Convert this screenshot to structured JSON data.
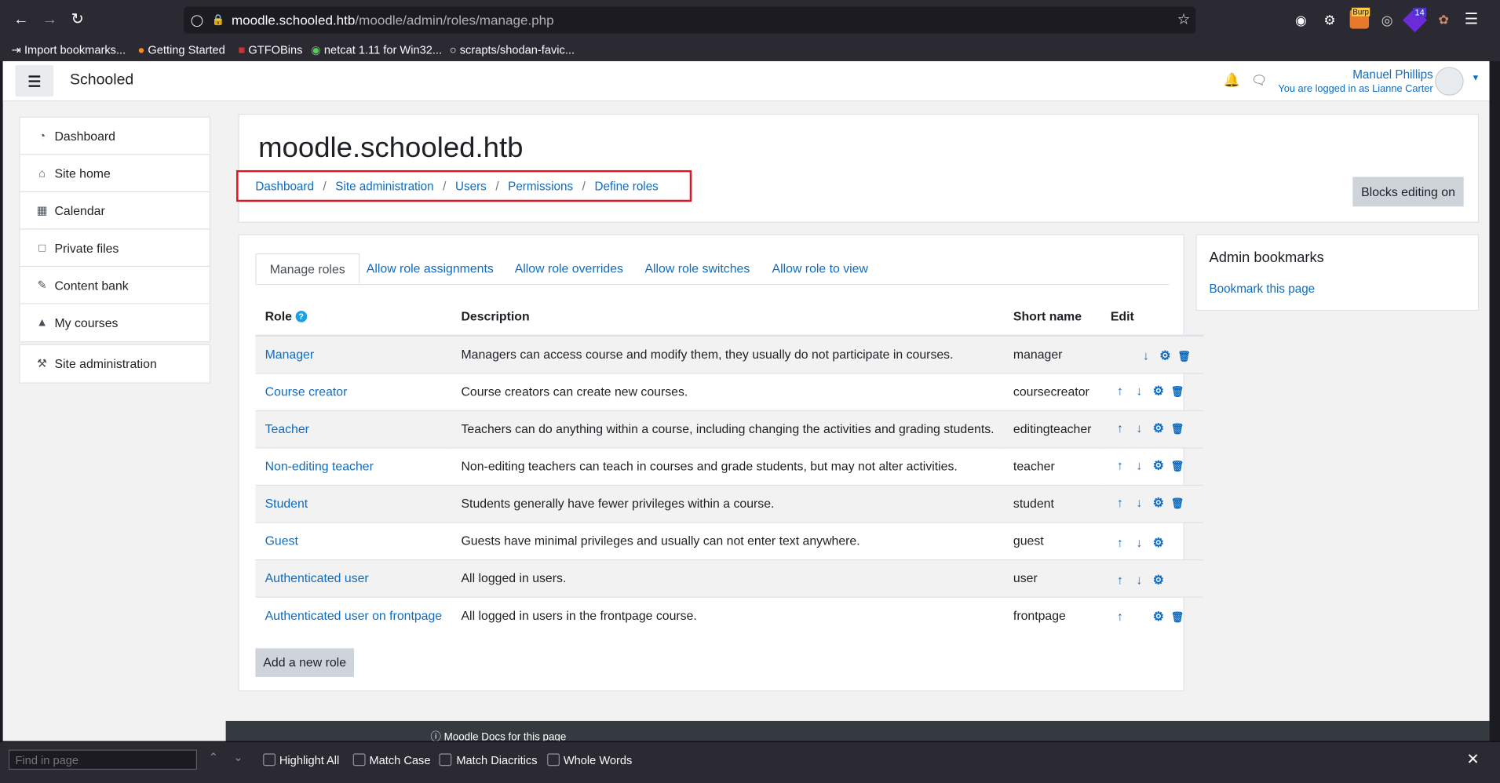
{
  "browser": {
    "url_host": "moodle.schooled.htb",
    "url_path": "/moodle/admin/roles/manage.php",
    "bookmarks": [
      {
        "label": "Import bookmarks...",
        "icon": "import-icon"
      },
      {
        "label": "Getting Started",
        "icon": "firefox-icon"
      },
      {
        "label": "GTFOBins",
        "icon": "gtfobins-icon"
      },
      {
        "label": "netcat 1.11 for Win32...",
        "icon": "netcat-icon"
      },
      {
        "label": "scrapts/shodan-favic...",
        "icon": "github-icon"
      }
    ],
    "extension_badge_burp": "Burp",
    "extension_badge_count": "14"
  },
  "navbar": {
    "site_name": "Schooled",
    "user_name": "Manuel Phillips",
    "logged_in_as": "You are logged in as Lianne Carter"
  },
  "sidebar": {
    "items": [
      {
        "label": "Dashboard",
        "icon": "dashboard-icon"
      },
      {
        "label": "Site home",
        "icon": "home-icon"
      },
      {
        "label": "Calendar",
        "icon": "calendar-icon"
      },
      {
        "label": "Private files",
        "icon": "file-icon"
      },
      {
        "label": "Content bank",
        "icon": "paintbrush-icon"
      },
      {
        "label": "My courses",
        "icon": "graduation-cap-icon"
      }
    ],
    "admin_item": {
      "label": "Site administration",
      "icon": "wrench-icon"
    }
  },
  "header": {
    "title": "moodle.schooled.htb",
    "breadcrumb": [
      "Dashboard",
      "Site administration",
      "Users",
      "Permissions",
      "Define roles"
    ],
    "separator": "/",
    "blocks_editing_label": "Blocks editing on",
    "highlight_color": "#e4151f"
  },
  "tabs": [
    "Manage roles",
    "Allow role assignments",
    "Allow role overrides",
    "Allow role switches",
    "Allow role to view"
  ],
  "table": {
    "headers": {
      "role": "Role",
      "description": "Description",
      "short_name": "Short name",
      "edit": "Edit"
    },
    "rows": [
      {
        "role": "Manager",
        "description": "Managers can access course and modify them, they usually do not participate in courses.",
        "short_name": "manager",
        "actions": [
          "",
          "down",
          "settings",
          "delete"
        ]
      },
      {
        "role": "Course creator",
        "description": "Course creators can create new courses.",
        "short_name": "coursecreator",
        "actions": [
          "up",
          "down",
          "settings",
          "delete"
        ]
      },
      {
        "role": "Teacher",
        "description": "Teachers can do anything within a course, including changing the activities and grading students.",
        "short_name": "editingteacher",
        "actions": [
          "up",
          "down",
          "settings",
          "delete"
        ]
      },
      {
        "role": "Non-editing teacher",
        "description": "Non-editing teachers can teach in courses and grade students, but may not alter activities.",
        "short_name": "teacher",
        "actions": [
          "up",
          "down",
          "settings",
          "delete"
        ]
      },
      {
        "role": "Student",
        "description": "Students generally have fewer privileges within a course.",
        "short_name": "student",
        "actions": [
          "up",
          "down",
          "settings",
          "delete"
        ]
      },
      {
        "role": "Guest",
        "description": "Guests have minimal privileges and usually can not enter text anywhere.",
        "short_name": "guest",
        "actions": [
          "up",
          "down",
          "settings",
          ""
        ]
      },
      {
        "role": "Authenticated user",
        "description": "All logged in users.",
        "short_name": "user",
        "actions": [
          "up",
          "down",
          "settings",
          ""
        ]
      },
      {
        "role": "Authenticated user on frontpage",
        "description": "All logged in users in the frontpage course.",
        "short_name": "frontpage",
        "actions": [
          "up",
          "",
          "settings",
          "delete"
        ]
      }
    ]
  },
  "add_role_label": "Add a new role",
  "admin_bookmarks": {
    "title": "Admin bookmarks",
    "link": "Bookmark this page"
  },
  "footer_partial": "Moodle Docs for this page",
  "findbar": {
    "placeholder": "Find in page",
    "options": [
      "Highlight All",
      "Match Case",
      "Match Diacritics",
      "Whole Words"
    ]
  }
}
